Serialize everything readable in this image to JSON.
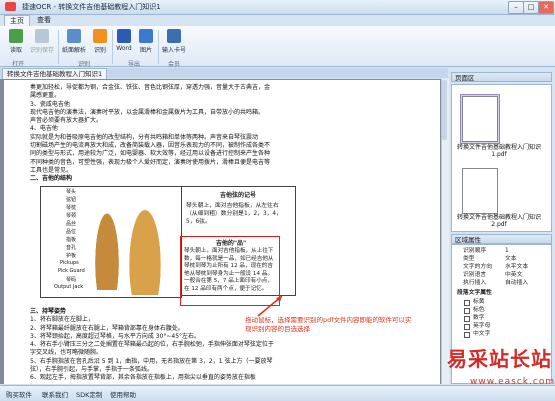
{
  "window": {
    "title": "捷速OCR - 转换文件吉他基础教程入门知识1",
    "minimize": "–",
    "maximize": "□",
    "close": "✕"
  },
  "tabs": [
    "主页",
    "查看"
  ],
  "ribbon": {
    "buttons": [
      "读取",
      "识别保存",
      "纸面解析",
      "识别",
      "Word",
      "图片",
      "输入卡号"
    ],
    "groups": [
      "打开",
      "识别",
      "导出",
      "会员"
    ]
  },
  "document": {
    "tab": "转换文件吉他基础教程入门知识1",
    "lines": [
      "奏更加轻松，导促都为钢，合金弦、铁弦、音色比钢弦厚，穿透力强，音量大于古典吉，金",
      "属感更重。",
      "3、瓷咸电吉他",
      "现代电吉他的演奏法，演奏时平放，以金属滑棒和金属拨片为工具，自带放小的共鸣箱。",
      "声音必须要有放大器扩大。",
      "4、电吉他",
      "实际就是为和普吸原电吉他的改型结构，分有共鸣箱和单体等两种。声音来自琴弦震动",
      "切割磁场产生的电流再放大和成，改备简装载入器，因音乐表现力的不同，被制作成各类不",
      "同的类型与形式，用途较为广泛，如电婴器、软大效等，经过用以设备进行控制来产生各种",
      "不同种类的音色，可塑性强，表现力极个人爱好而定，演奏时使用拨片，滑棒且便是电吉等",
      "工具也是常见。",
      "二、吉他的结构"
    ],
    "fig_labels": [
      "琴头",
      "弦钮",
      "琴枕",
      "琴颈",
      "品丝",
      "品位",
      "指板",
      "音孔",
      "护板",
      "Pickups",
      "Pick Guard",
      "琴码",
      "Output Jack"
    ],
    "fig_right": {
      "title": "吉他弦的记号",
      "body": "琴头朝上，面对吉他指板，从左往右（从细到粗）数分别是1，2，3，4，5，6弦。",
      "box_title": "吉他的\"品\"",
      "box_body": "琴头朝上，面对吉他指板，从上往下数，每一格就是一品，如已经吉他从琴枕到琴为止所有 12 品，现在的吉他从琴枕到琴身为止一般设 14 品。一般合在第 5，7 品上面印有小点，在 12 品印有两个点，便于记忆。"
    },
    "lines2": [
      "三、持琴姿势",
      "1、将右脚放在左脚上，",
      "2、将琴箱最纤腿放在右腿上，琴箱背部靠在身体右腹处。",
      "3、将琴颈抬起，高度超过琴格，与水平方向成 30°~45°左右。",
      "4、将右手小臂压三分之二处搁置在琴箱最凸起的位，右手腕松弛，手指伸张面对琴弦定位于",
      "字交叉线，也可略微随腕。",
      "5、右手腕指放在音孔后沿 5 到 1，曲指，中用，无名指放在第 3，2，1 弦上方（一要放琴",
      "弦），右手腕引起，与手掌，手指于一条弧线。",
      "6、观起左手，拇指放置琴背部，其余各指放在指板上，用指尖以垂直的姿势放在指板"
    ],
    "annotation": "拖动鼠标，选择需要识别的pdf文件内容即能的软件可以实现识别内容的目选选择"
  },
  "thumbnails": {
    "title": "页面区",
    "items": [
      "转换文件吉他基础教程入门知识1.pdf",
      "转换文件吉他基础教程入门知识2.pdf"
    ]
  },
  "properties": {
    "title": "区域属性",
    "rows": [
      {
        "k": "识别顺序",
        "v": "1"
      },
      {
        "k": "类型",
        "v": "文本"
      },
      {
        "k": "文字的方向",
        "v": "水平文本"
      },
      {
        "k": "识别语言",
        "v": "中英文"
      },
      {
        "k": "执行插入",
        "v": "自动插入"
      }
    ],
    "section": "段落文字属性",
    "checks": [
      "标黄",
      "标色",
      "数字",
      "英字母",
      "中文字"
    ]
  },
  "status": [
    "购买软件",
    "联系我们",
    "SDK定制",
    "使用帮助"
  ],
  "watermark": {
    "main": "易采站长站",
    "url": "www.easck.com"
  }
}
